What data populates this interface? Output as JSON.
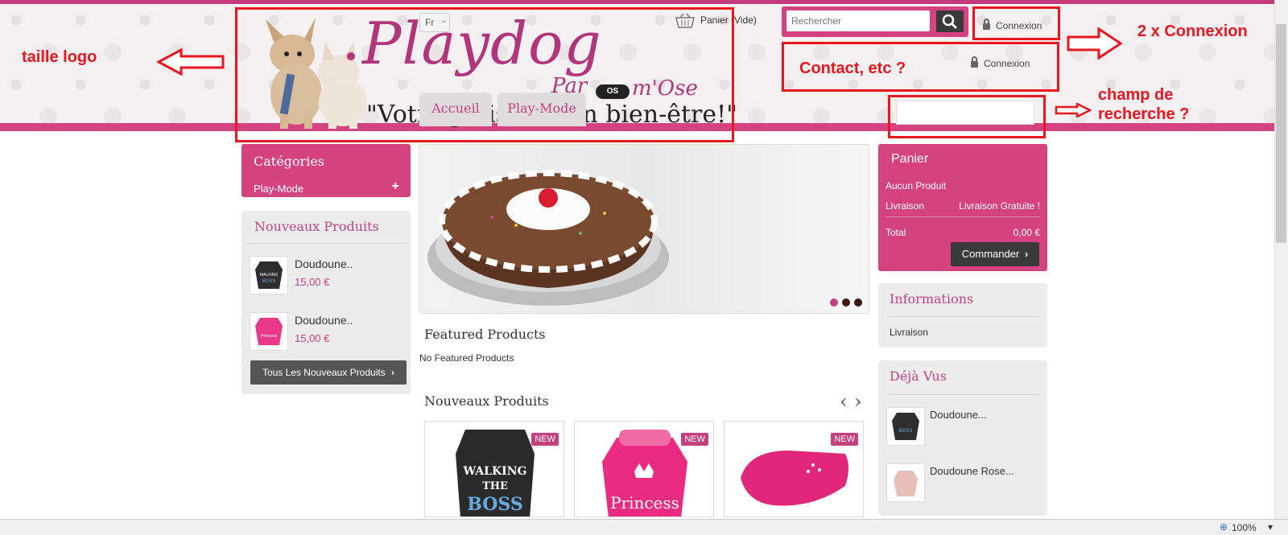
{
  "header": {
    "logo_title": "Playdog",
    "logo_par": "Par",
    "logo_bone": "OS",
    "logo_mrose": "m'Ose",
    "tagline": "\"Votre plaisir... son bien-être!\"",
    "lang": "Fr",
    "nav": [
      "Accueil",
      "Play-Mode"
    ],
    "cart_label": "Panier (Vide)",
    "search_placeholder": "Rechercher",
    "connexion": "Connexion",
    "connexion2": "Connexion"
  },
  "annotations": {
    "logo_size": "taille logo",
    "double_login": "2 x Connexion",
    "contact": "Contact, etc ?",
    "search_field_1": "champ de",
    "search_field_2": "recherche ?"
  },
  "left": {
    "categories_title": "Catégories",
    "category_item": "Play-Mode",
    "category_plus": "+",
    "new_products_title": "Nouveaux Produits",
    "products": [
      {
        "name": "Doudoune..",
        "price": "15,00 €"
      },
      {
        "name": "Doudoune..",
        "price": "15,00 €"
      }
    ],
    "all_new_btn": "Tous Les Nouveaux Produits"
  },
  "center": {
    "featured_title": "Featured Products",
    "featured_empty": "No Featured Products",
    "new_title": "Nouveaux Produits",
    "prev": "‹",
    "next": "›",
    "badge": "NEW",
    "card_texts": [
      "WALKING\nTHE",
      "BOSS",
      "Princess"
    ]
  },
  "right": {
    "cart_title": "Panier",
    "no_product": "Aucun Produit",
    "shipping_label": "Livraison",
    "shipping_value": "Livraison Gratuite !",
    "total_label": "Total",
    "total_value": "0,00 €",
    "order_btn": "Commander",
    "info_title": "Informations",
    "info_item": "Livraison",
    "viewed_title": "Déjà Vus",
    "viewed": [
      "Doudoune...",
      "Doudoune Rose..."
    ]
  },
  "status": {
    "zoom": "100%"
  },
  "colors": {
    "brand": "#d4427f",
    "annotation": "#e8161f",
    "dark": "#3a3a3a"
  }
}
